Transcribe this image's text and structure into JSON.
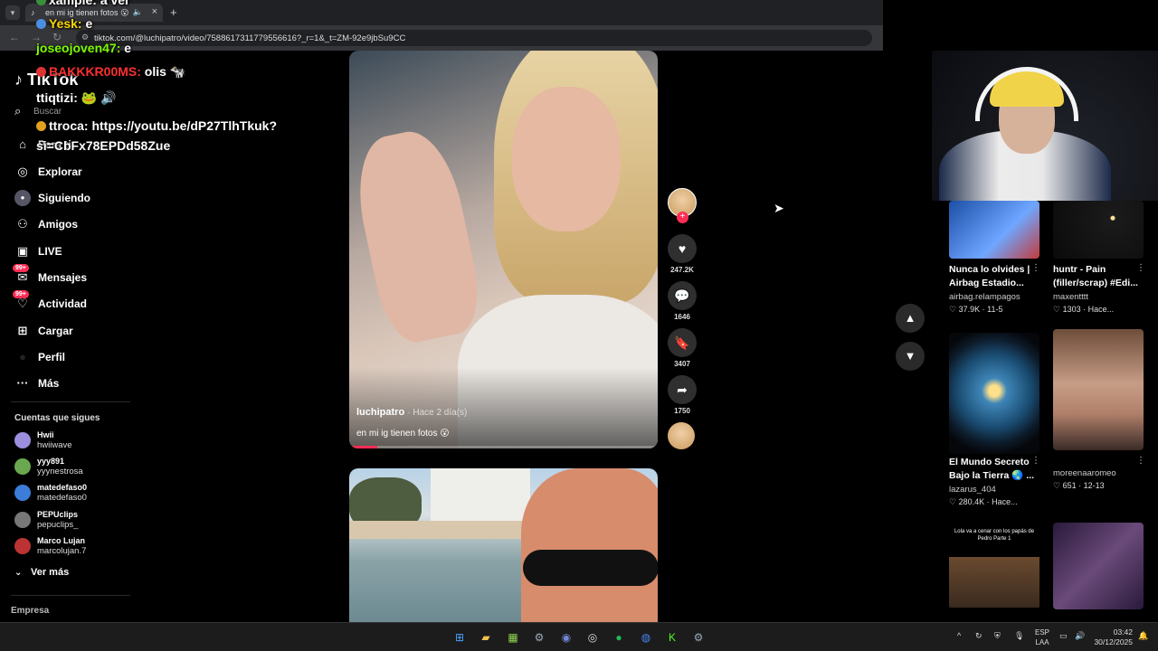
{
  "browser": {
    "tab_title": "en mi ig tienen fotos 😮",
    "url": "tiktok.com/@luchipatro/video/7588617311779556616?_r=1&_t=ZM-92e9jbSu9CC"
  },
  "chat": [
    {
      "user": "xample:",
      "text": "a ver",
      "color": "#ffffff"
    },
    {
      "user": "Yesk:",
      "text": "e",
      "color": "#ffd700"
    },
    {
      "user": "joseojoven47:",
      "text": "e",
      "color": "#7cfc00"
    },
    {
      "user": "BAKKKR00MS:",
      "text": "olis 🐄",
      "color": "#ff3030"
    },
    {
      "user": "ttiqtizi:",
      "text": "🐸 🔊",
      "color": "#ffffff"
    },
    {
      "user": "ttroca:",
      "text": "https://youtu.be/dP27TlhTkuk?si=CbFx78EPDd58Zue",
      "color": "#ffffff"
    }
  ],
  "sidebar": {
    "logo": "TikTok",
    "search_placeholder": "Buscar",
    "items": [
      {
        "label": "Para ti",
        "icon": "home-icon",
        "glyph": "⌂"
      },
      {
        "label": "Explorar",
        "icon": "compass-icon",
        "glyph": "◎"
      },
      {
        "label": "Siguiendo",
        "icon": "following-avatar-icon",
        "glyph": "●"
      },
      {
        "label": "Amigos",
        "icon": "friends-icon",
        "glyph": "👥"
      },
      {
        "label": "LIVE",
        "icon": "live-icon",
        "glyph": "▣"
      },
      {
        "label": "Mensajes",
        "icon": "messages-icon",
        "glyph": "✉",
        "badge": "99+"
      },
      {
        "label": "Actividad",
        "icon": "activity-icon",
        "glyph": "♡",
        "badge": "99+"
      },
      {
        "label": "Cargar",
        "icon": "upload-icon",
        "glyph": "⊞"
      },
      {
        "label": "Perfil",
        "icon": "profile-icon",
        "glyph": "●"
      },
      {
        "label": "Más",
        "icon": "more-icon",
        "glyph": "···"
      }
    ],
    "following_title": "Cuentas que sigues",
    "accounts": [
      {
        "name": "Hwii",
        "handle": "hwiiwave",
        "color": "#9c8fe0"
      },
      {
        "name": "yyy891",
        "handle": "yyynestrosa",
        "color": "#6aa84f"
      },
      {
        "name": "matedefaso0",
        "handle": "matedefaso0",
        "color": "#3b7dd8"
      },
      {
        "name": "PEPUclips",
        "handle": "pepuclips_",
        "color": "#777777"
      },
      {
        "name": "Marco Lujan",
        "handle": "marcolujan.7",
        "color": "#b33"
      }
    ],
    "see_more": "Ver más",
    "company": "Empresa"
  },
  "video": {
    "author": "luchipatro",
    "ago": "· Hace 2 día(s)",
    "caption": "en mi ig tienen fotos 😮",
    "progress": 0.09,
    "likes": "247.2K",
    "comments": "1646",
    "saves": "3407",
    "shares": "1750"
  },
  "right_grid": [
    {
      "title": "Nunca lo olvides | Airbag Estadio...",
      "user": "airbag.relampagos",
      "likes": "37.9K",
      "date": "11-5"
    },
    {
      "title": "huntr - Pain (filler/scrap) #Edi...",
      "user": "maxentttt",
      "likes": "1303",
      "date": "Hace..."
    },
    {
      "title": "El Mundo Secreto Bajo la Tierra 🌏 ...",
      "user": "lazarus_404",
      "likes": "280.4K",
      "date": "Hace..."
    },
    {
      "title": "",
      "user": "moreenaaromeo",
      "likes": "651",
      "date": "12-13"
    },
    {
      "thumb_text": "Lola va a cenar con los papás de Pedro Parte 1"
    }
  ],
  "taskbar": {
    "lang_line1": "ESP",
    "lang_line2": "LAA",
    "time": "03:42",
    "date": "30/12/2025"
  }
}
